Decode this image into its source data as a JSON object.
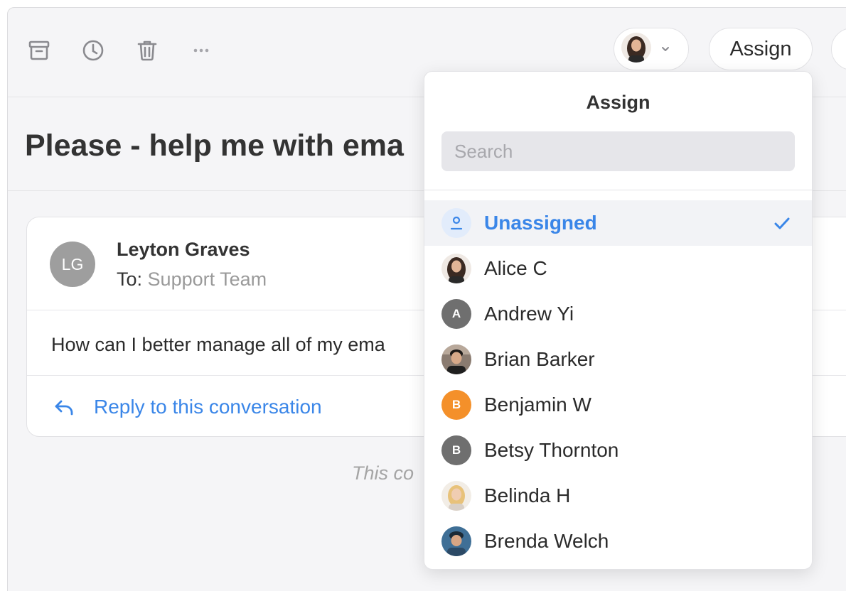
{
  "toolbar": {
    "icons": [
      "archive-icon",
      "clock-icon",
      "trash-icon",
      "more-icon"
    ],
    "assign_label": "Assign"
  },
  "subject": "Please - help me with ema",
  "message": {
    "avatar_initials": "LG",
    "avatar_color": "#9e9e9e",
    "sender": "Leyton Graves",
    "to_prefix": "To:",
    "to_name": "Support Team",
    "body": "How can I better manage all of my ema",
    "reply_label": "Reply to this conversation"
  },
  "footer_note": "This co",
  "dropdown": {
    "title": "Assign",
    "search_placeholder": "Search",
    "items": [
      {
        "name": "Unassigned",
        "selected": true,
        "avatar": "user-icon"
      },
      {
        "name": "Alice C",
        "avatar": "photo"
      },
      {
        "name": "Andrew Yi",
        "avatar_initial": "A",
        "avatar_color": "#6f6f6f"
      },
      {
        "name": "Brian Barker",
        "avatar": "photo"
      },
      {
        "name": "Benjamin W",
        "avatar_initial": "B",
        "avatar_color": "#f4902a"
      },
      {
        "name": "Betsy Thornton",
        "avatar_initial": "B",
        "avatar_color": "#6f6f6f"
      },
      {
        "name": "Belinda H",
        "avatar": "photo"
      },
      {
        "name": "Brenda Welch",
        "avatar": "photo"
      }
    ]
  },
  "colors": {
    "accent": "#3a86e8",
    "background": "#f5f5f7"
  }
}
